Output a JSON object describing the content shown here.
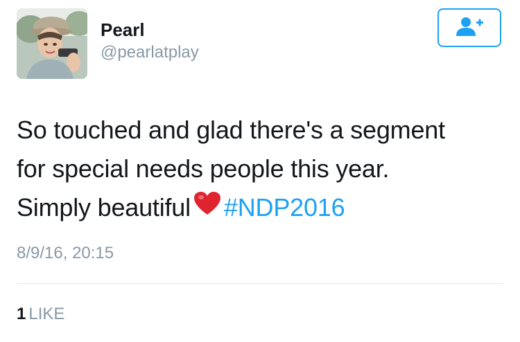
{
  "tweet": {
    "author": {
      "display_name": "Pearl",
      "handle": "@pearlatplay",
      "avatar_icon": "profile-photo"
    },
    "follow_button": {
      "icon": "add-user-icon",
      "color": "#1da1f2"
    },
    "text": {
      "line1": "So touched and glad there's a segment",
      "line2": "for special needs people this year.",
      "line3_prefix": "Simply beautiful",
      "emoji": "red-heart",
      "hashtag": "#NDP2016"
    },
    "timestamp": "8/9/16, 20:15",
    "stats": {
      "like_count": "1",
      "like_label": "LIKE"
    }
  },
  "colors": {
    "accent": "#1da1f2",
    "muted": "#8899a6",
    "text": "#14171a",
    "divider": "#e1e8ed"
  }
}
